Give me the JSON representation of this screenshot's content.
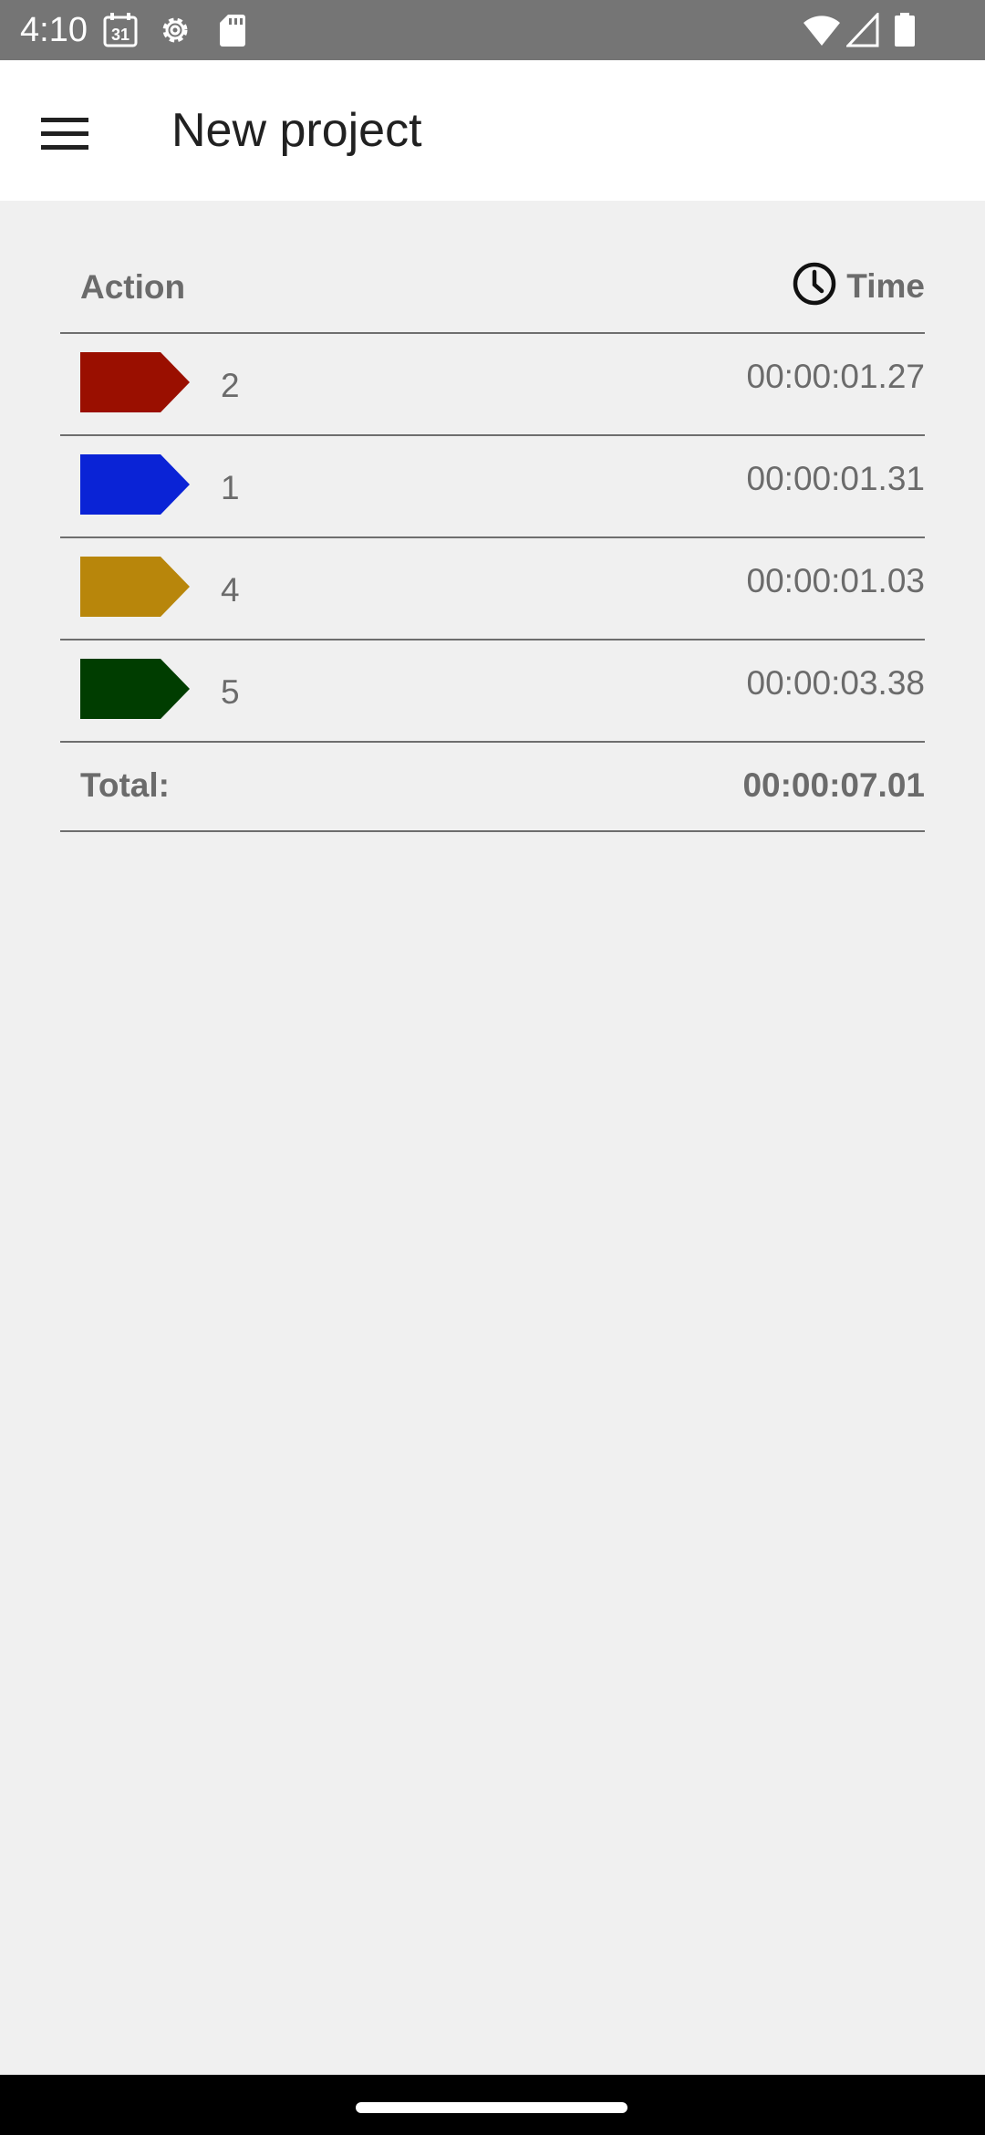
{
  "status_bar": {
    "time": "4:10",
    "calendar_day": "31",
    "icons": [
      "calendar-icon",
      "settings-gear-icon",
      "sd-card-icon",
      "wifi-icon",
      "signal-icon",
      "battery-icon"
    ]
  },
  "app_bar": {
    "title": "New project",
    "menu_icon": "hamburger-menu-icon"
  },
  "table": {
    "header_action": "Action",
    "header_time": "Time",
    "header_time_icon": "clock-icon",
    "rows": [
      {
        "label": "2",
        "time": "00:00:01.27",
        "color": "#9a0f00"
      },
      {
        "label": "1",
        "time": "00:00:01.31",
        "color": "#0a23d6"
      },
      {
        "label": "4",
        "time": "00:00:01.03",
        "color": "#b8860b"
      },
      {
        "label": "5",
        "time": "00:00:03.38",
        "color": "#003d00"
      }
    ],
    "total_label": "Total:",
    "total_value": "00:00:07.01"
  },
  "colors": {
    "status_bar_bg": "#757575",
    "app_bar_bg": "#ffffff",
    "content_bg": "#f0f0f0",
    "text_secondary": "#6b6b6b",
    "nav_bar_bg": "#000000"
  }
}
